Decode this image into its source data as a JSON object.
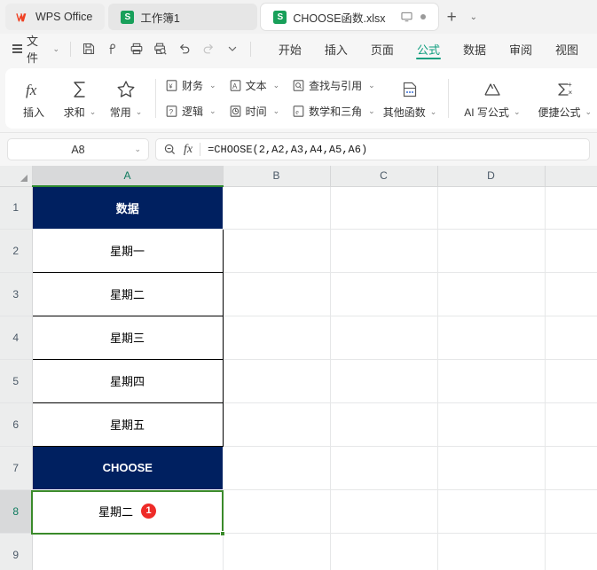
{
  "tabbar": {
    "home_label": "WPS Office",
    "home_icon": "wps-logo-icon",
    "tabs": [
      {
        "label": "工作簿1",
        "icon": "spreadsheet-icon",
        "letter": "S",
        "active": false
      },
      {
        "label": "CHOOSE函数.xlsx",
        "icon": "spreadsheet-icon",
        "letter": "S",
        "active": true
      }
    ],
    "monitor_icon": "monitor-icon",
    "status_dot": "status-dot-icon",
    "new_tab": "+",
    "tab_menu_chevron": "⌄"
  },
  "menubar": {
    "file_label": "文件",
    "file_chevron": "⌄",
    "quick_access": [
      {
        "name": "save-icon",
        "title": "保存"
      },
      {
        "name": "share-icon",
        "title": "分享"
      },
      {
        "name": "print-icon",
        "title": "打印"
      },
      {
        "name": "print-preview-icon",
        "title": "打印预览"
      },
      {
        "name": "undo-icon",
        "title": "撤销"
      },
      {
        "name": "redo-icon",
        "title": "恢复"
      },
      {
        "name": "chevron-down-icon",
        "title": "自定义"
      }
    ],
    "ribbon_tabs": [
      {
        "label": "开始",
        "active": false
      },
      {
        "label": "插入",
        "active": false
      },
      {
        "label": "页面",
        "active": false
      },
      {
        "label": "公式",
        "active": true
      },
      {
        "label": "数据",
        "active": false
      },
      {
        "label": "审阅",
        "active": false
      },
      {
        "label": "视图",
        "active": false
      }
    ]
  },
  "ribbon": {
    "big_buttons": [
      {
        "label": "插入",
        "icon": "fx-icon",
        "has_chevron": false
      },
      {
        "label": "求和",
        "icon": "sigma-icon",
        "has_chevron": true
      },
      {
        "label": "常用",
        "icon": "star-icon",
        "has_chevron": true
      }
    ],
    "function_groups": [
      {
        "label": "财务",
        "icon": "finance-icon",
        "has_chevron": true
      },
      {
        "label": "文本",
        "icon": "text-icon",
        "has_chevron": true
      },
      {
        "label": "查找与引用",
        "icon": "lookup-icon",
        "has_chevron": true
      },
      {
        "label": "逻辑",
        "icon": "logical-icon",
        "has_chevron": true
      },
      {
        "label": "时间",
        "icon": "time-icon",
        "has_chevron": true
      },
      {
        "label": "数学和三角",
        "icon": "math-icon",
        "has_chevron": true
      }
    ],
    "other_functions": {
      "label": "其他函数",
      "icon": "more-functions-icon",
      "has_chevron": true
    },
    "right_buttons": [
      {
        "label": "AI 写公式",
        "icon": "ai-formula-icon",
        "has_chevron": true
      },
      {
        "label": "便捷公式",
        "icon": "quick-formula-icon",
        "has_chevron": true
      }
    ]
  },
  "formula_bar": {
    "name_box_value": "A8",
    "name_box_chevron": "⌄",
    "zoom_icon": "magnifier-minus-icon",
    "fx_label": "fx",
    "formula": "=CHOOSE(2,A2,A3,A4,A5,A6)"
  },
  "sheet": {
    "columns": [
      "A",
      "B",
      "C",
      "D"
    ],
    "selected_column": "A",
    "rows": [
      "1",
      "2",
      "3",
      "4",
      "5",
      "6",
      "7",
      "8",
      "9"
    ],
    "selected_row": "8",
    "selected_cell": "A8",
    "cells": [
      {
        "row": "1",
        "a": "数据",
        "style": "navy"
      },
      {
        "row": "2",
        "a": "星期一",
        "style": "plain"
      },
      {
        "row": "3",
        "a": "星期二",
        "style": "boxed"
      },
      {
        "row": "4",
        "a": "星期三",
        "style": "boxed"
      },
      {
        "row": "5",
        "a": "星期四",
        "style": "boxed"
      },
      {
        "row": "6",
        "a": "星期五",
        "style": "boxed"
      },
      {
        "row": "7",
        "a": "CHOOSE",
        "style": "navy"
      },
      {
        "row": "8",
        "a": "星期二",
        "style": "selected",
        "badge": "1"
      },
      {
        "row": "9",
        "a": "",
        "style": "plain"
      }
    ],
    "colors": {
      "header_fill": "#002060",
      "header_text": "#ffffff",
      "selection_border": "#3a8a2a",
      "badge_fill": "#ee2b28",
      "column_header_bg": "#eceded"
    }
  }
}
